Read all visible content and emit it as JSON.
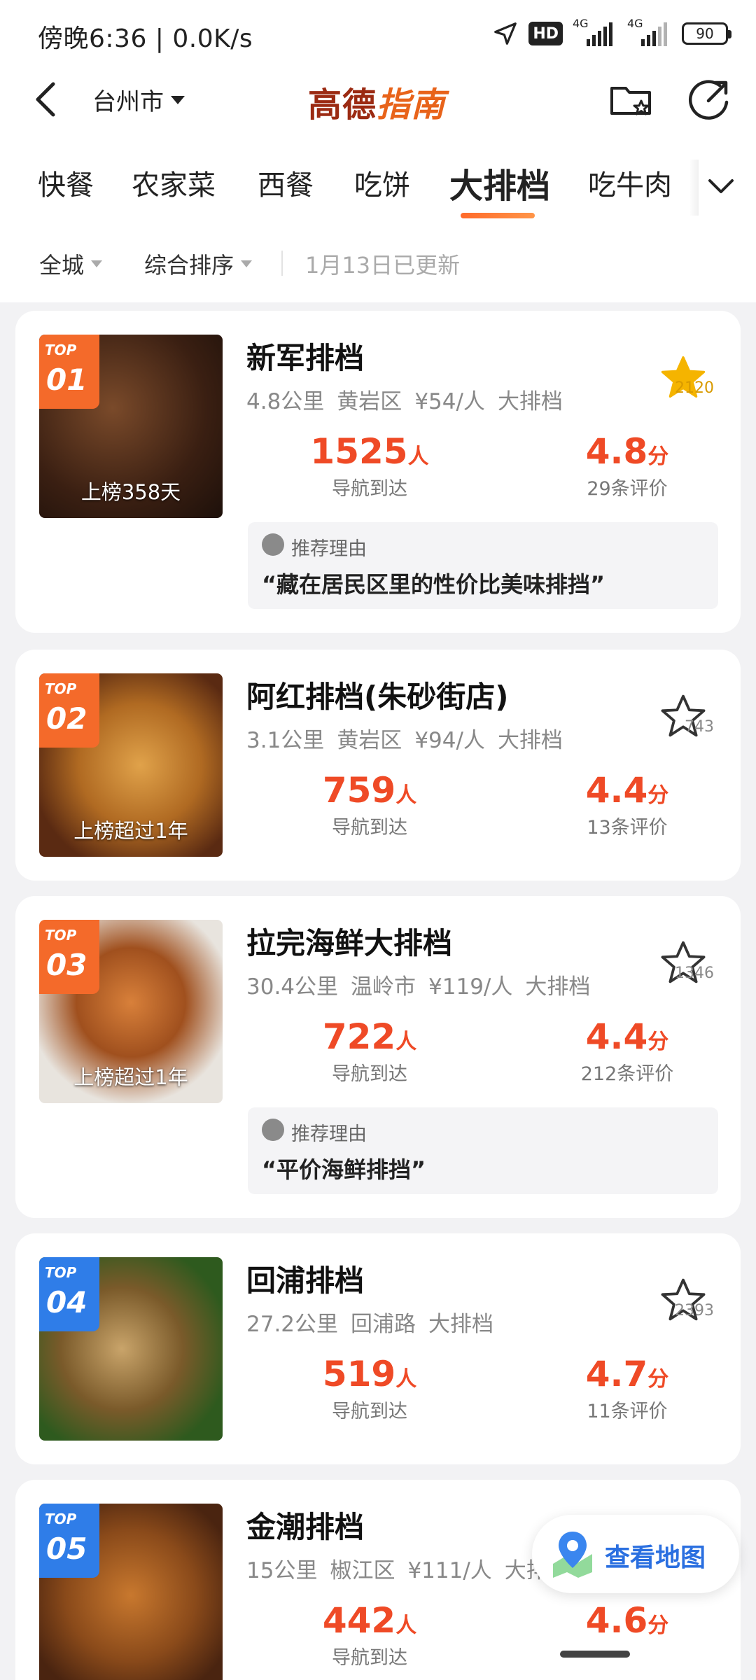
{
  "status": {
    "time": "傍晚6:36 | 0.0K/s",
    "hd": "HD",
    "net1": "4G",
    "net2": "4G",
    "battery": "90"
  },
  "header": {
    "city": "台州市",
    "brand_a": "高德",
    "brand_b": "指南",
    "back_icon": "back-arrow-icon",
    "folder_icon": "folder-star-icon",
    "share_icon": "share-icon"
  },
  "tabs": [
    "快餐",
    "农家菜",
    "西餐",
    "吃饼",
    "大排档",
    "吃牛肉"
  ],
  "active_tab": "大排档",
  "filters": {
    "area": "全城",
    "sort": "综合排序",
    "updated": "1月13日已更新"
  },
  "colors": {
    "accent": "#ef4a26",
    "rank_orange": "#f46a2a",
    "rank_blue": "#2f7de8",
    "favorite_gold": "#f5b400",
    "map_blue": "#2a6fe0"
  },
  "reason_label": "推荐理由",
  "nav_label": "导航到达",
  "people_unit": "人",
  "score_unit": "分",
  "restaurants": [
    {
      "rank_top": "TOP",
      "rank_num": "01",
      "days": "上榜358天",
      "name": "新军排档",
      "distance": "4.8公里",
      "area": "黄岩区",
      "price": "¥54/人",
      "category": "大排档",
      "favorites": "2120",
      "favorited": true,
      "navigations": "1525",
      "score": "4.8",
      "reviews": "29条评价",
      "reason": "“藏在居民区里的性价比美味排挡”"
    },
    {
      "rank_top": "TOP",
      "rank_num": "02",
      "days": "上榜超过1年",
      "name": "阿红排档(朱砂街店)",
      "distance": "3.1公里",
      "area": "黄岩区",
      "price": "¥94/人",
      "category": "大排档",
      "favorites": "743",
      "favorited": false,
      "navigations": "759",
      "score": "4.4",
      "reviews": "13条评价",
      "reason": ""
    },
    {
      "rank_top": "TOP",
      "rank_num": "03",
      "days": "上榜超过1年",
      "name": "拉完海鲜大排档",
      "distance": "30.4公里",
      "area": "温岭市",
      "price": "¥119/人",
      "category": "大排档",
      "favorites": "1346",
      "favorited": false,
      "navigations": "722",
      "score": "4.4",
      "reviews": "212条评价",
      "reason": "“平价海鲜排挡”"
    },
    {
      "rank_top": "TOP",
      "rank_num": "04",
      "days": "",
      "name": "回浦排档",
      "distance": "27.2公里",
      "area": "回浦路",
      "price": "",
      "category": "大排档",
      "favorites": "2393",
      "favorited": false,
      "navigations": "519",
      "score": "4.7",
      "reviews": "11条评价",
      "reason": ""
    },
    {
      "rank_top": "TOP",
      "rank_num": "05",
      "days": "",
      "name": "金潮排档",
      "distance": "15公里",
      "area": "椒江区",
      "price": "¥111/人",
      "category": "大排",
      "favorites": "",
      "favorited": false,
      "navigations": "442",
      "score": "4.6",
      "reviews": "",
      "reason": ""
    }
  ],
  "map_button": "查看地图"
}
